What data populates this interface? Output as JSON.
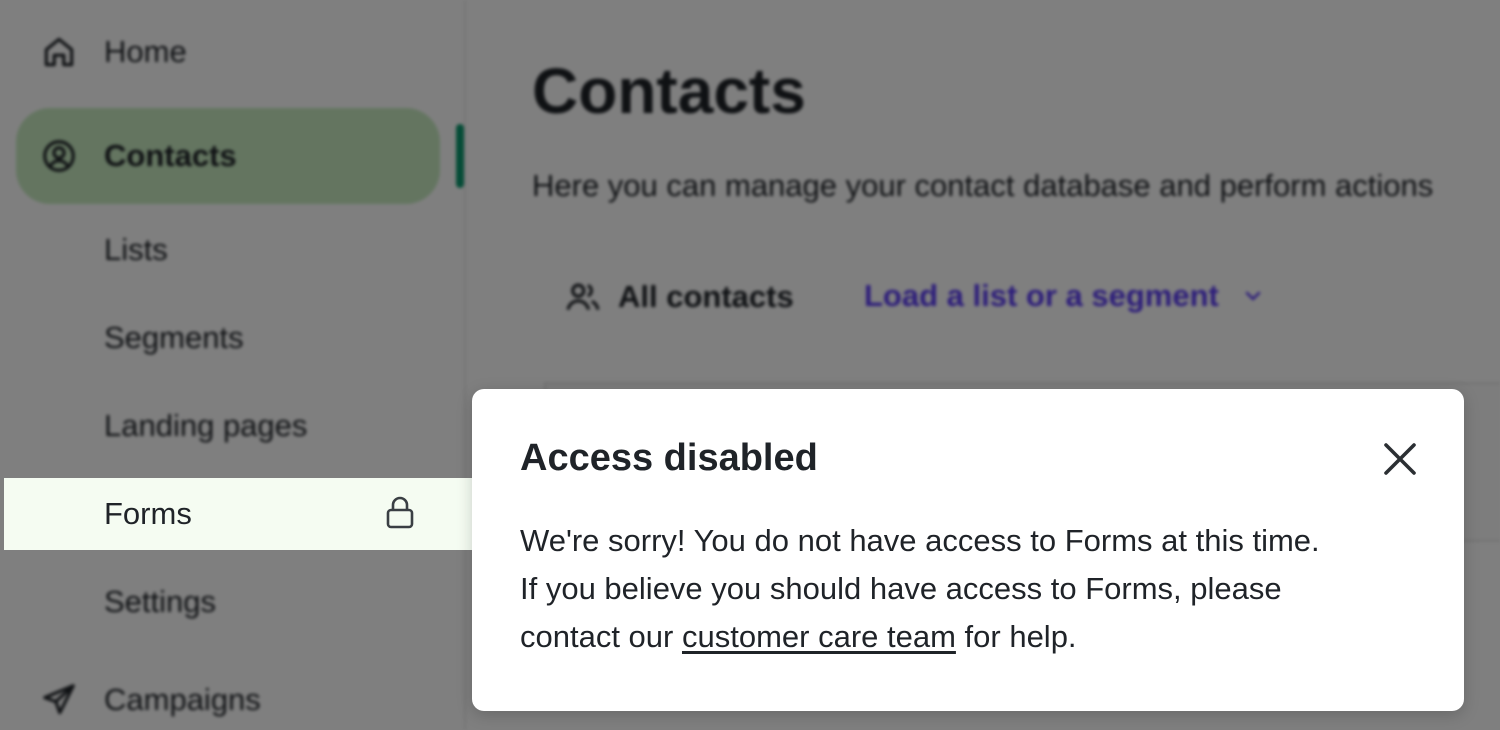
{
  "sidebar": {
    "home_label": "Home",
    "contacts_label": "Contacts",
    "sub_items": {
      "lists": "Lists",
      "segments": "Segments",
      "landing_pages": "Landing pages",
      "forms": "Forms",
      "settings": "Settings"
    },
    "campaigns_label": "Campaigns"
  },
  "main": {
    "title": "Contacts",
    "description": "Here you can manage your contact database and perform actions",
    "all_contacts_label": "All contacts",
    "load_list_label": "Load a list or a segment"
  },
  "modal": {
    "title": "Access disabled",
    "line1": "We're sorry! You do not have access to Forms at this time.",
    "line2": "If you believe you should have access to Forms, please",
    "line3_before": "contact our ",
    "link_text": "customer care team",
    "line3_after": " for help."
  },
  "colors": {
    "active_nav_bg": "#c8ebc1",
    "active_indicator": "#0b996e",
    "link_accent": "#5b3cf5",
    "overlay": "rgba(0,0,0,0.5)"
  },
  "icons": {
    "home": "home-icon",
    "contacts": "user-circle-icon",
    "campaigns": "paper-plane-icon",
    "all_contacts": "users-icon",
    "dropdown": "chevron-down-icon",
    "forms_lock": "lock-icon",
    "close": "close-icon"
  }
}
